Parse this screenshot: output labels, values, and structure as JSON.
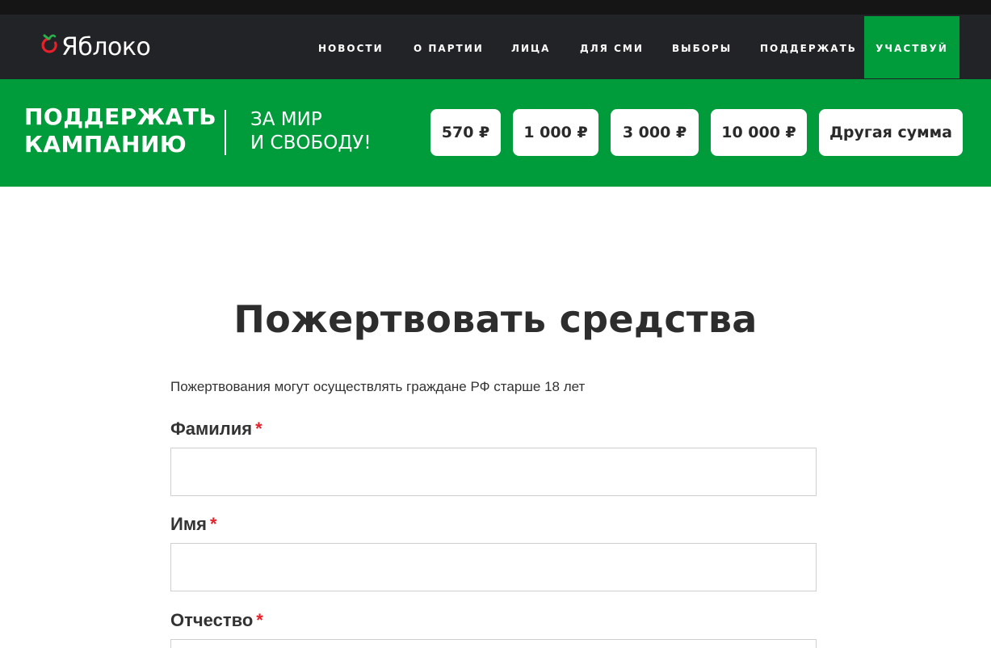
{
  "header": {
    "logo_text": "Яблоко",
    "nav": [
      {
        "label": "НОВОСТИ"
      },
      {
        "label": "О ПАРТИИ"
      },
      {
        "label": "ЛИЦА"
      },
      {
        "label": "ДЛЯ СМИ"
      },
      {
        "label": "ВЫБОРЫ"
      },
      {
        "label": "ПОДДЕРЖАТЬ"
      }
    ],
    "cta_label": "УЧАСТВУЙ"
  },
  "donate_bar": {
    "title_line1": "ПОДДЕРЖАТЬ",
    "title_line2": "КАМПАНИЮ",
    "slogan_line1": "ЗА МИР",
    "slogan_line2": "И СВОБОДУ!",
    "amounts": [
      "570 ₽",
      "1 000 ₽",
      "3 000 ₽",
      "10 000 ₽",
      "Другая сумма"
    ]
  },
  "form": {
    "title": "Пожертвовать средства",
    "notice": "Пожертвования могут осуществлять граждане РФ старше 18 лет",
    "required_mark": "*",
    "fields": [
      {
        "label": "Фамилия",
        "value": ""
      },
      {
        "label": "Имя",
        "value": ""
      },
      {
        "label": "Отчество",
        "value": ""
      }
    ]
  },
  "colors": {
    "brand_green": "#009b3a",
    "header_dark": "#222326",
    "logo_red": "#e8202a",
    "required_red": "#e8202a"
  }
}
